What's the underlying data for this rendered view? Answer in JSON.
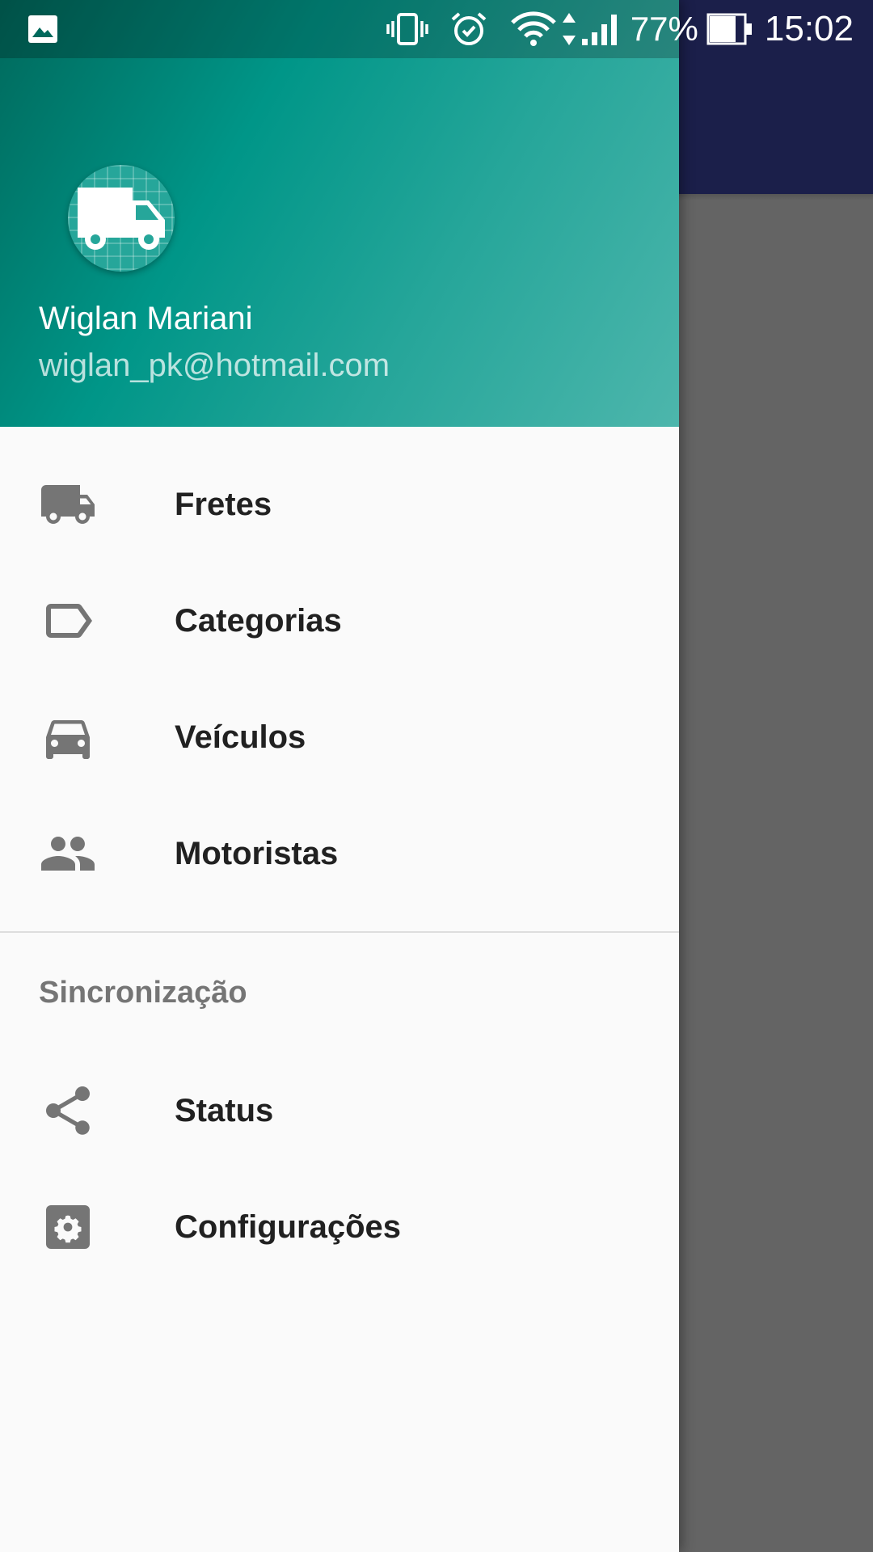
{
  "status_bar": {
    "battery_percent": "77%",
    "time": "15:02",
    "icons": [
      "gallery-icon",
      "vibrate-icon",
      "alarm-icon",
      "wifi-icon",
      "signal-icon",
      "battery-icon"
    ]
  },
  "drawer": {
    "header": {
      "avatar_icon": "truck-icon",
      "user_name": "Wiglan Mariani",
      "user_email": "wiglan_pk@hotmail.com",
      "gradient_start": "#00695c",
      "gradient_end": "#4db6ac"
    },
    "items": [
      {
        "label": "Fretes",
        "icon": "truck-icon"
      },
      {
        "label": "Categorias",
        "icon": "label-icon"
      },
      {
        "label": "Veículos",
        "icon": "car-icon"
      },
      {
        "label": "Motoristas",
        "icon": "people-icon"
      }
    ],
    "section": {
      "title": "Sincronização",
      "items": [
        {
          "label": "Status",
          "icon": "share-icon"
        },
        {
          "label": "Configurações",
          "icon": "settings-icon"
        }
      ]
    }
  },
  "colors": {
    "app_toolbar": "#1b1f4a",
    "scrim": "#646464",
    "icon_gray": "#757575",
    "text_dark": "#212121"
  }
}
